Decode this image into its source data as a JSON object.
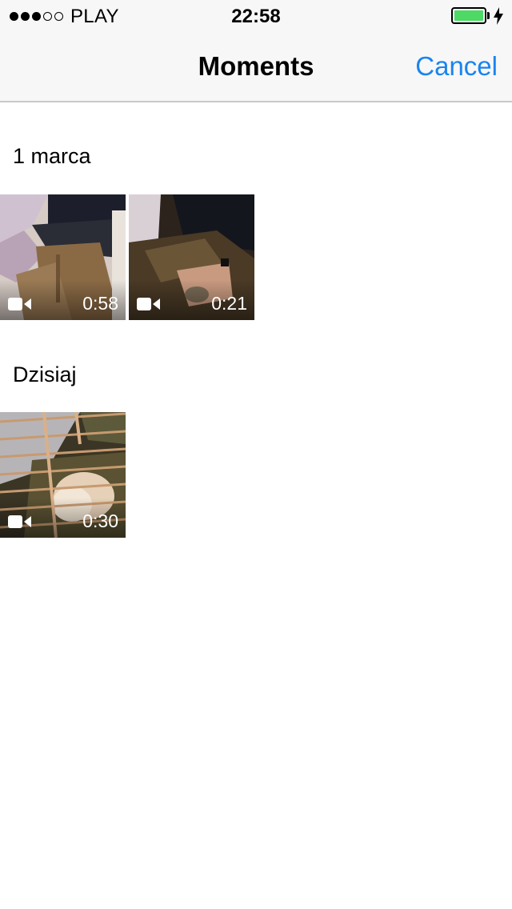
{
  "status_bar": {
    "signal": {
      "filled": 3,
      "total": 5
    },
    "carrier": "PLAY",
    "time": "22:58",
    "battery_level": 1.0,
    "battery_color": "#4cd964",
    "charging_icon": "charging-bolt-icon"
  },
  "nav": {
    "title": "Moments",
    "cancel_label": "Cancel",
    "accent_color": "#1a84ee"
  },
  "moments": [
    {
      "title": "1 marca",
      "videos": [
        {
          "duration": "0:58",
          "icon": "video-camera-icon"
        },
        {
          "duration": "0:21",
          "icon": "video-camera-icon"
        }
      ]
    },
    {
      "title": "Dzisiaj",
      "videos": [
        {
          "duration": "0:30",
          "icon": "video-camera-icon"
        }
      ]
    }
  ]
}
